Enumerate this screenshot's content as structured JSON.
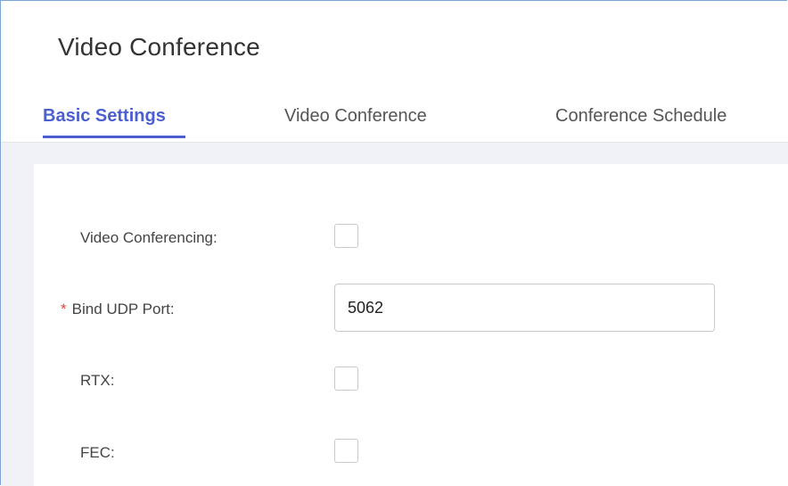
{
  "page": {
    "title": "Video Conference"
  },
  "tabs": [
    {
      "label": "Basic Settings",
      "active": true
    },
    {
      "label": "Video Conference",
      "active": false
    },
    {
      "label": "Conference Schedule",
      "active": false
    }
  ],
  "form": {
    "video_conferencing": {
      "label": "Video Conferencing",
      "separator": ":",
      "checked": false
    },
    "bind_udp_port": {
      "required_mark": "*",
      "label": "Bind UDP Port",
      "separator": ":",
      "value": "5062"
    },
    "rtx": {
      "label": "RTX",
      "separator": ":",
      "checked": false
    },
    "fec": {
      "label": "FEC",
      "separator": ":",
      "checked": false
    }
  },
  "colors": {
    "accent": "#4b5fd1",
    "required": "#e0443a",
    "frame_border": "#7aa7d6",
    "content_bg": "#f0f2f5"
  }
}
